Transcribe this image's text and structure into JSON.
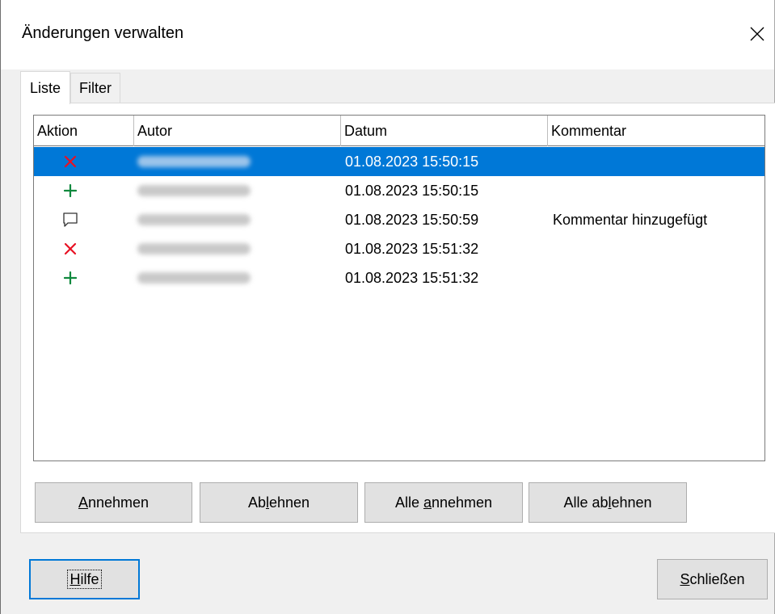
{
  "window": {
    "title": "Änderungen verwalten"
  },
  "tabs": [
    {
      "label": "Liste",
      "active": true
    },
    {
      "label": "Filter",
      "active": false
    }
  ],
  "columns": [
    "Aktion",
    "Autor",
    "Datum",
    "Kommentar"
  ],
  "rows": [
    {
      "action_icon": "delete-x-icon",
      "author": "",
      "date": "01.08.2023 15:50:15",
      "comment": "",
      "selected": true
    },
    {
      "action_icon": "insert-plus-icon",
      "author": "",
      "date": "01.08.2023 15:50:15",
      "comment": "",
      "selected": false
    },
    {
      "action_icon": "comment-bubble-icon",
      "author": "",
      "date": "01.08.2023 15:50:59",
      "comment": "Kommentar hinzugefügt",
      "selected": false
    },
    {
      "action_icon": "delete-x-icon",
      "author": "",
      "date": "01.08.2023 15:51:32",
      "comment": "",
      "selected": false
    },
    {
      "action_icon": "insert-plus-icon",
      "author": "",
      "date": "01.08.2023 15:51:32",
      "comment": "",
      "selected": false
    }
  ],
  "actions": {
    "accept": {
      "pre": "",
      "key": "A",
      "post": "nnehmen"
    },
    "reject": {
      "pre": "Ab",
      "key": "l",
      "post": "ehnen"
    },
    "accept_all": {
      "pre": "Alle ",
      "key": "a",
      "post": "nnehmen"
    },
    "reject_all": {
      "pre": "Alle ab",
      "key": "l",
      "post": "ehnen"
    }
  },
  "footer": {
    "help": {
      "pre": "",
      "key": "H",
      "post": "ilfe"
    },
    "close": {
      "pre": "",
      "key": "S",
      "post": "chließen"
    }
  },
  "colors": {
    "selection": "#0078d7",
    "delete_icon": "#e81123",
    "insert_icon": "#10893e"
  }
}
